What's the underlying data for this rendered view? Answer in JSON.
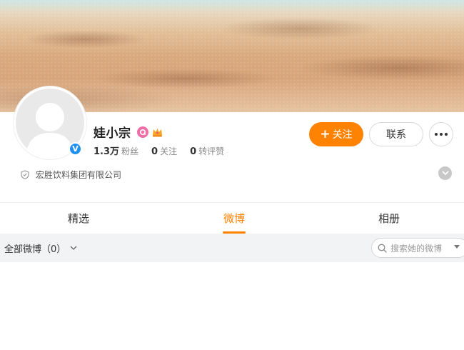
{
  "profile": {
    "name": "娃小宗",
    "badge_icon": "pink-badge-icon",
    "crown_icon": "crown-icon",
    "verified_icon": "verified-v-icon",
    "verified_glyph": "V",
    "stats": [
      {
        "num": "1.3万",
        "label": "粉丝"
      },
      {
        "num": "0",
        "label": "关注"
      },
      {
        "num": "0",
        "label": "转评赞"
      }
    ],
    "company": "宏胜饮料集团有限公司"
  },
  "actions": {
    "follow_plus": "+",
    "follow_label": "关注",
    "contact_label": "联系"
  },
  "tabs": [
    {
      "label": "精选"
    },
    {
      "label": "微博"
    },
    {
      "label": "相册"
    }
  ],
  "filter": {
    "label": "全部微博（0）",
    "search_placeholder": "搜索她的微博"
  },
  "colors": {
    "accent": "#ff8200",
    "verified": "#1f8ff2",
    "badge_pink": "#ef6ea8"
  }
}
